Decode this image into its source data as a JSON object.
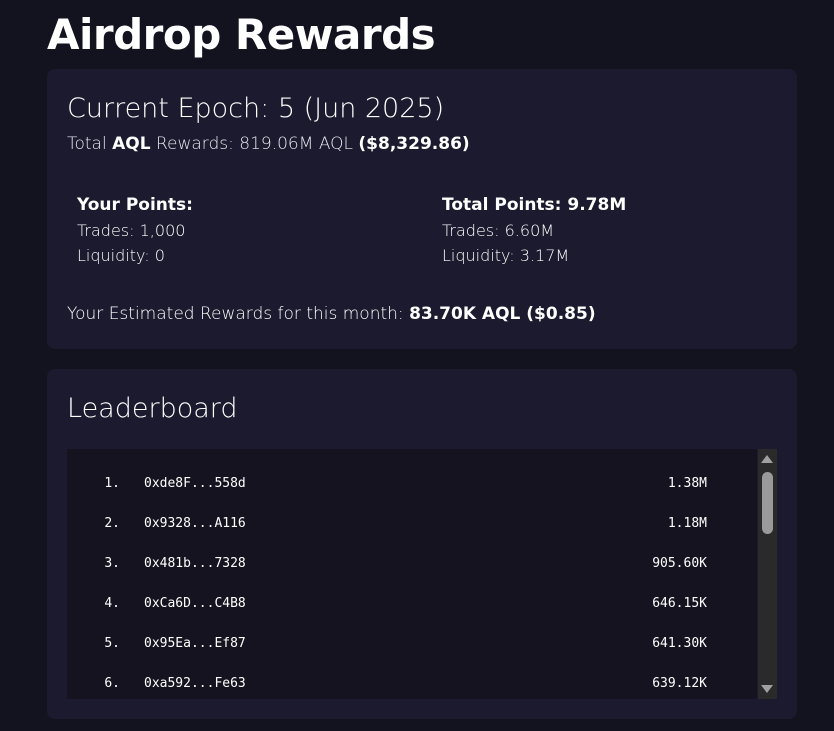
{
  "page": {
    "title": "Airdrop Rewards"
  },
  "epoch": {
    "heading": "Current Epoch: 5 (Jun 2025)",
    "total_prefix": "Total ",
    "total_token": "AQL",
    "total_mid": " Rewards: 819.06M AQL ",
    "total_usd": "($8,329.86)"
  },
  "your_points": {
    "heading": "Your Points:",
    "trades": "Trades: 1,000",
    "liquidity": "Liquidity: 0"
  },
  "total_points": {
    "heading": "Total Points: 9.78M",
    "trades": "Trades: 6.60M",
    "liquidity": "Liquidity: 3.17M"
  },
  "estimate": {
    "prefix": "Your Estimated Rewards for this month: ",
    "value": "83.70K AQL ($0.85)"
  },
  "leaderboard": {
    "heading": "Leaderboard",
    "rows": [
      {
        "rank": "1.",
        "address": "0xde8F...558d",
        "points": "1.38M"
      },
      {
        "rank": "2.",
        "address": "0x9328...A116",
        "points": "1.18M"
      },
      {
        "rank": "3.",
        "address": "0x481b...7328",
        "points": "905.60K"
      },
      {
        "rank": "4.",
        "address": "0xCa6D...C4B8",
        "points": "646.15K"
      },
      {
        "rank": "5.",
        "address": "0x95Ea...Ef87",
        "points": "641.30K"
      },
      {
        "rank": "6.",
        "address": "0xa592...Fe63",
        "points": "639.12K"
      }
    ]
  },
  "icons": {
    "scroll_up": "scroll-up-arrow-icon",
    "scroll_down": "scroll-down-arrow-icon"
  }
}
